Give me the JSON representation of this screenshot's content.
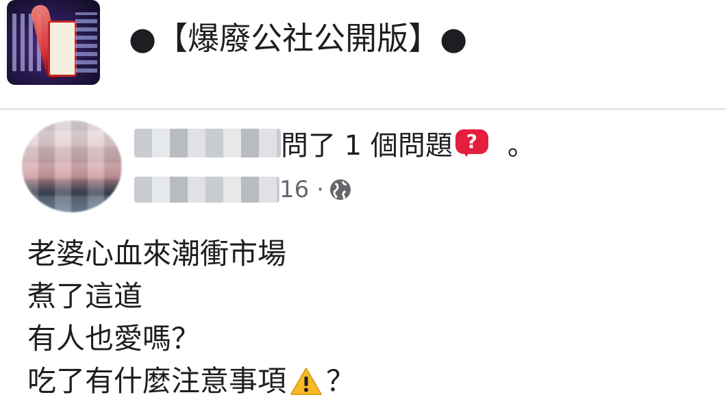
{
  "group": {
    "title": "●【爆廢公社公開版】●",
    "logo_icon": "group-logo-image"
  },
  "post": {
    "author_suffix": "問了 1 個問題",
    "question_icon": "question-mark-icon",
    "question_icon_glyph": "?",
    "period": "。",
    "date_suffix": "16 ·",
    "privacy_icon": "globe-icon",
    "body_lines": [
      "老婆心血來潮衝市場",
      "煮了這道",
      "有人也愛嗎？",
      "吃了有什麼注意事項"
    ],
    "last_line_end": "？",
    "warning_icon": "warning-icon"
  },
  "colors": {
    "text": "#1c1e21",
    "secondary_text": "#65676b",
    "question_badge": "#e41e3f",
    "warning_yellow": "#f7b928",
    "divider": "#e4e6eb"
  }
}
